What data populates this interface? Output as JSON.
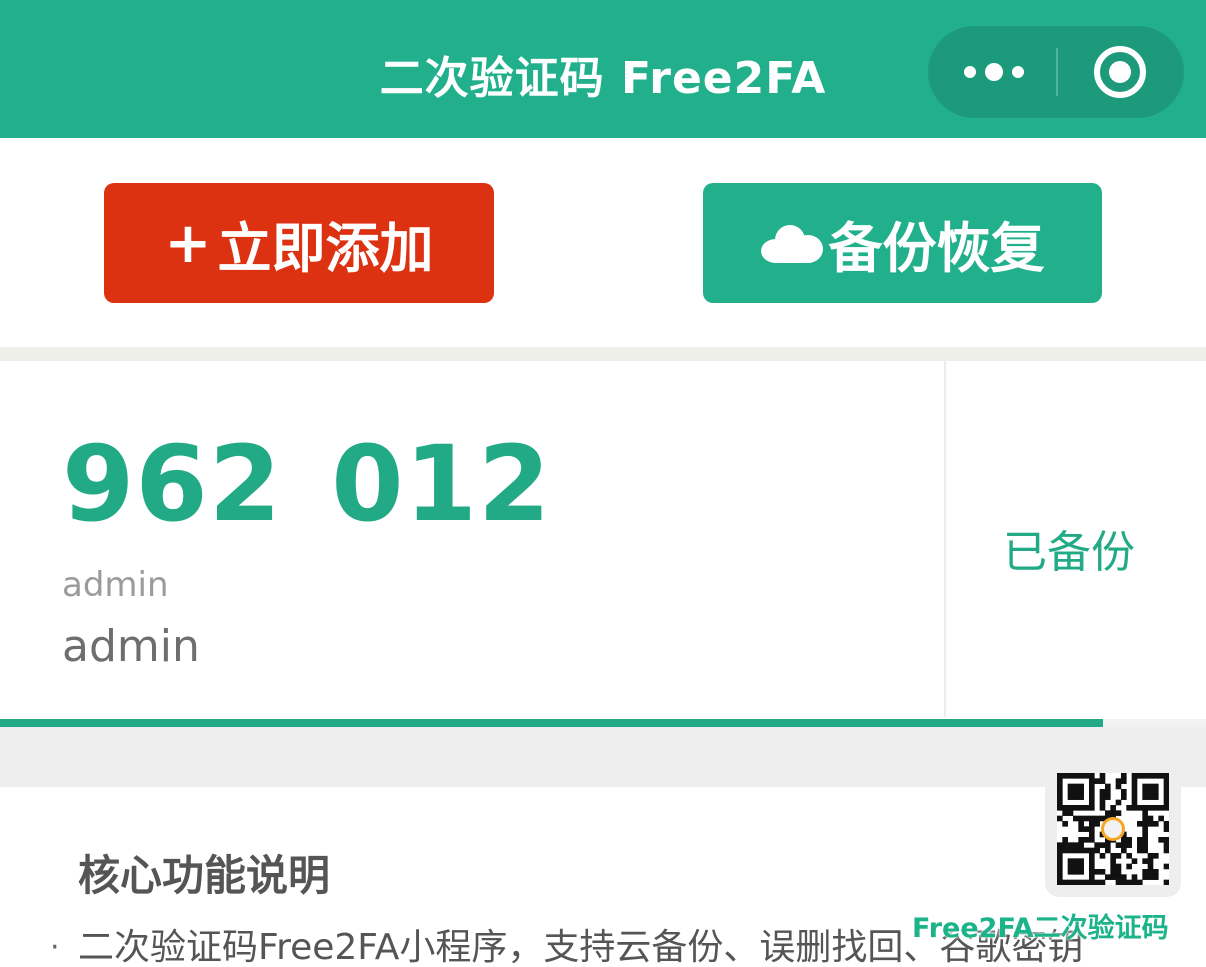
{
  "header": {
    "title": "二次验证码 Free2FA",
    "more_icon": "more-dots-icon",
    "close_icon": "target-close-icon",
    "color": "#22b08c"
  },
  "actions": {
    "add_label": "立即添加",
    "add_icon_glyph": "+",
    "add_color": "#dc3212",
    "backup_label": "备份恢复",
    "backup_icon": "cloud-icon",
    "backup_color": "#22b08c"
  },
  "token": {
    "code": "962 012",
    "issuer": "admin",
    "account": "admin",
    "status": "已备份",
    "countdown_fraction": 0.915,
    "accent": "#22aa86"
  },
  "features": {
    "title": "核心功能说明",
    "bullet": "·",
    "description": "二次验证码Free2FA小程序，支持云备份、误删找回、谷歌密钥"
  },
  "watermark": {
    "text": "Free2FA二次验证码",
    "qr_icon": "qr-code-icon"
  }
}
